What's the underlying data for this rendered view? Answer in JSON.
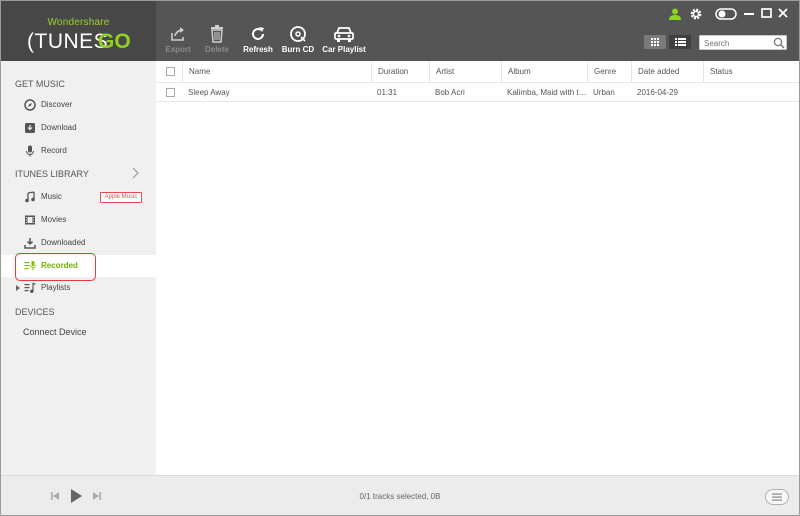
{
  "brand": {
    "small": "Wondershare",
    "big": "TUNESGO"
  },
  "toolbar": {
    "export_label": "Export",
    "delete_label": "Delete",
    "refresh_label": "Refresh",
    "burn_cd_label": "Burn CD",
    "car_playlist_label": "Car Playlist"
  },
  "search": {
    "placeholder": "Search"
  },
  "colors": {
    "accent": "#7ac200",
    "topbar": "#555555",
    "logo_bg": "#474747",
    "highlight_outline": "#e53b3b"
  },
  "sidebar": {
    "get_music_header": "GET MUSIC",
    "discover": "Discover",
    "download": "Download",
    "record": "Record",
    "itunes_header": "ITUNES LIBRARY",
    "music": "Music",
    "apple_music_badge": "Apple Music",
    "movies": "Movies",
    "downloaded": "Downloaded",
    "recorded": "Recorded",
    "playlists": "Playlists",
    "devices_header": "DEVICES",
    "connect_device": "Connect Device"
  },
  "table": {
    "headers": {
      "name": "Name",
      "duration": "Duration",
      "artist": "Artist",
      "album": "Album",
      "genre": "Genre",
      "date_added": "Date added",
      "status": "Status"
    },
    "rows": [
      {
        "name": "Sleep Away",
        "duration": "01:31",
        "artist": "Bob Acri",
        "album": "Kalimba, Maid with th...",
        "genre": "Urban",
        "date_added": "2016-04-29",
        "status": ""
      }
    ]
  },
  "status_bar": {
    "text": "0/1 tracks selected, 0B"
  }
}
